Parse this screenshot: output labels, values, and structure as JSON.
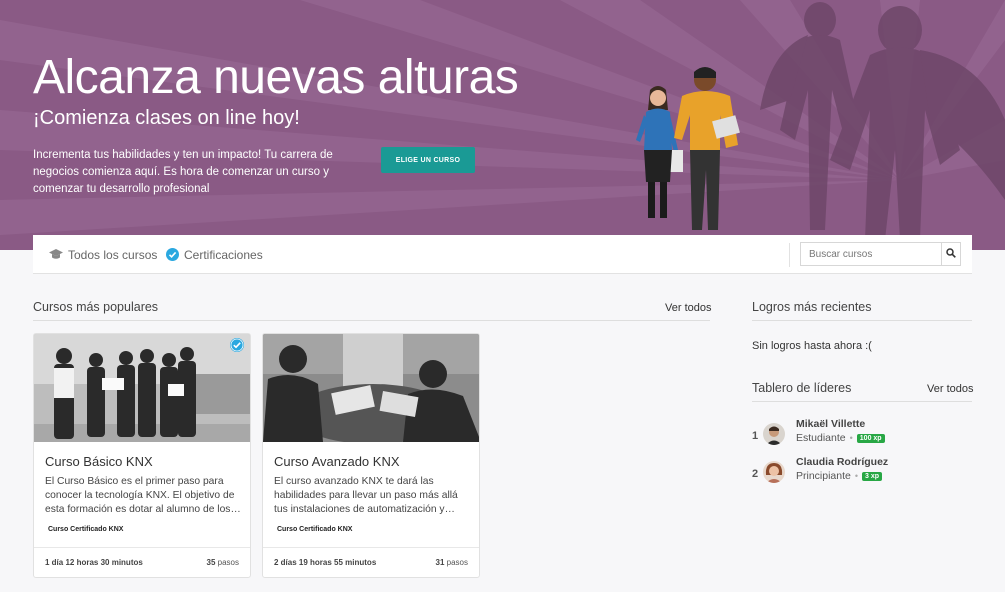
{
  "hero": {
    "title": "Alcanza nuevas alturas",
    "subtitle": "¡Comienza clases on line hoy!",
    "description": "Incrementa tus habilidades y ten un impacto! Tu carrera de negocios comienza aquí. Es hora de comenzar un curso y comenzar tu desarrollo profesional",
    "cta_label": "ELIGE UN CURSO",
    "background_color": "#8a5a85",
    "cta_color": "#1a9a95"
  },
  "nav": {
    "items": [
      {
        "label": "Todos los cursos",
        "icon": "graduation-cap-icon"
      },
      {
        "label": "Certificaciones",
        "icon": "check-badge-icon"
      }
    ],
    "search": {
      "placeholder": "Buscar cursos",
      "icon": "search-icon"
    }
  },
  "popular": {
    "title": "Cursos más populares",
    "see_all": "Ver todos",
    "courses": [
      {
        "title": "Curso Básico KNX",
        "description": "El Curso Básico es el primer paso para conocer la tecnología KNX. El objetivo de esta formación es dotar al alumno de los…",
        "tag": "Curso Certificado KNX",
        "duration": "1 día 12 horas 30 minutos",
        "steps_count": "35",
        "steps_label": "pasos",
        "completed": true
      },
      {
        "title": "Curso Avanzado KNX",
        "description": "El curso avanzado KNX te dará las habilidades para llevar un paso más allá tus instalaciones de automatización y…",
        "tag": "Curso Certificado KNX",
        "duration": "2 días 19 horas 55 minutos",
        "steps_count": "31",
        "steps_label": "pasos",
        "completed": false
      }
    ]
  },
  "achievements": {
    "title": "Logros más recientes",
    "empty_message": "Sin logros hasta ahora :("
  },
  "leaderboard": {
    "title": "Tablero de líderes",
    "see_all": "Ver todos",
    "entries": [
      {
        "rank": "1",
        "name": "Mikaël Villette",
        "role": "Estudiante",
        "xp": "100 xp"
      },
      {
        "rank": "2",
        "name": "Claudia Rodríguez",
        "role": "Principiante",
        "xp": "3 xp"
      }
    ]
  },
  "colors": {
    "accent": "#1a9a95",
    "badge": "#28a745",
    "check": "#2aa8e0"
  }
}
